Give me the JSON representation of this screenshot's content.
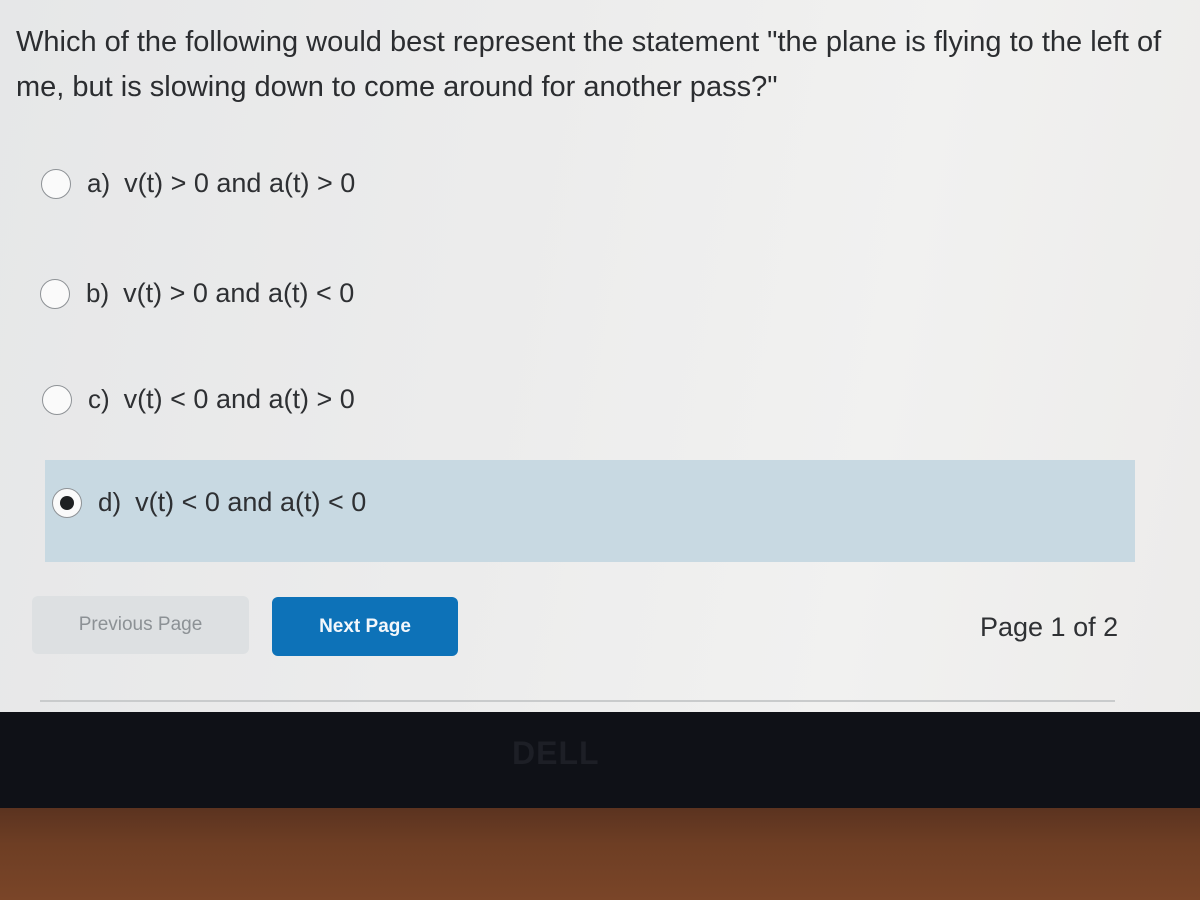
{
  "question": {
    "text": "Which of the following would best represent the statement \"the plane is flying to the left of me, but is slowing down to come around for another pass?\""
  },
  "options": [
    {
      "letter": "a)",
      "text": "v(t) > 0 and a(t) > 0",
      "selected": false
    },
    {
      "letter": "b)",
      "text": "v(t) > 0 and a(t) < 0",
      "selected": false
    },
    {
      "letter": "c)",
      "text": "v(t) < 0 and a(t) > 0",
      "selected": false
    },
    {
      "letter": "d)",
      "text": "v(t) < 0 and a(t) < 0",
      "selected": true
    }
  ],
  "navigation": {
    "previous_label": "Previous Page",
    "next_label": "Next Page",
    "page_indicator": "Page 1 of 2"
  },
  "device": {
    "brand_logo": "DELL"
  },
  "colors": {
    "next_button": "#0d72b8",
    "selected_option_bg": "#c8d9e2"
  }
}
